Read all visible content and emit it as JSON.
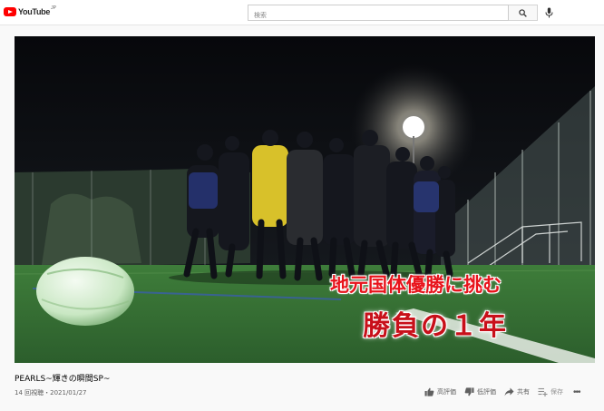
{
  "header": {
    "logo_text": "YouTube",
    "logo_superscript": "JP",
    "search_placeholder": "検索"
  },
  "video": {
    "caption_line1": "地元国体優勝に挑む",
    "caption_line2": "勝負の１年",
    "caption_color": "#e8141c",
    "title": "PEARLS~輝きの瞬間SP~",
    "meta": "14 回視聴・2021/01/27"
  },
  "actions": {
    "like": "高評価",
    "dislike": "低評価",
    "share": "共有",
    "save": "保存"
  },
  "icons": [
    "youtube-logo-icon",
    "search-icon",
    "microphone-icon",
    "thumbs-up-icon",
    "thumbs-down-icon",
    "share-icon",
    "save-playlist-icon",
    "more-options-icon"
  ]
}
